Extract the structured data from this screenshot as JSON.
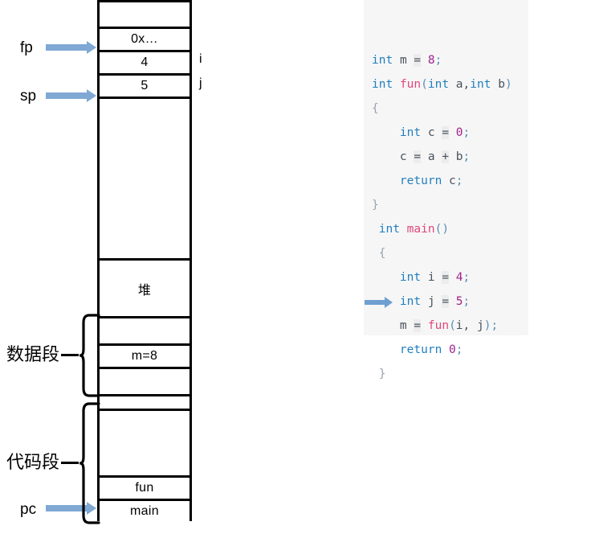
{
  "diagram": {
    "title": "stack-memory-layout",
    "pointer_labels": [
      {
        "name": "fp",
        "text": "fp"
      },
      {
        "name": "sp",
        "text": "sp"
      },
      {
        "name": "pc",
        "text": "pc"
      }
    ],
    "segment_labels": [
      {
        "name": "data-segment",
        "text": "数据段"
      },
      {
        "name": "code-segment",
        "text": "代码段"
      }
    ],
    "side_labels": [
      {
        "name": "var-i",
        "text": "i"
      },
      {
        "name": "var-j",
        "text": "j"
      }
    ],
    "cells": [
      {
        "name": "cell-empty-top",
        "text": ""
      },
      {
        "name": "cell-return-address",
        "text": "0x…"
      },
      {
        "name": "cell-i-value",
        "text": "4"
      },
      {
        "name": "cell-j-value",
        "text": "5"
      },
      {
        "name": "cell-stack-free",
        "text": ""
      },
      {
        "name": "cell-heap",
        "text": "堆"
      },
      {
        "name": "cell-data-upper",
        "text": ""
      },
      {
        "name": "cell-global-m",
        "text": "m=8"
      },
      {
        "name": "cell-data-lower",
        "text": ""
      },
      {
        "name": "cell-gap",
        "text": ""
      },
      {
        "name": "cell-code-free",
        "text": ""
      },
      {
        "name": "cell-fun",
        "text": "fun"
      },
      {
        "name": "cell-main",
        "text": "main"
      }
    ]
  },
  "code_panel": {
    "name": "source-code-panel",
    "language": "c",
    "current_line_index": 10,
    "lines": [
      [
        {
          "t": "int",
          "c": "kw"
        },
        {
          "t": " ",
          "c": "pl"
        },
        {
          "t": "m",
          "c": "pl"
        },
        {
          "t": " ",
          "c": "pl"
        },
        {
          "t": "=",
          "c": "op"
        },
        {
          "t": " ",
          "c": "pl"
        },
        {
          "t": "8",
          "c": "num"
        },
        {
          "t": ";",
          "c": "sem"
        }
      ],
      [
        {
          "t": "int",
          "c": "kw"
        },
        {
          "t": " ",
          "c": "pl"
        },
        {
          "t": "fun",
          "c": "fn"
        },
        {
          "t": "(",
          "c": "sem"
        },
        {
          "t": "int",
          "c": "kw"
        },
        {
          "t": " a,",
          "c": "pl"
        },
        {
          "t": "int",
          "c": "kw"
        },
        {
          "t": " b",
          "c": "pl"
        },
        {
          "t": ")",
          "c": "sem"
        }
      ],
      [
        {
          "t": "{",
          "c": "brc"
        }
      ],
      [
        {
          "t": "    ",
          "c": "pl"
        },
        {
          "t": "int",
          "c": "kw"
        },
        {
          "t": " ",
          "c": "pl"
        },
        {
          "t": "c",
          "c": "pl"
        },
        {
          "t": " ",
          "c": "pl"
        },
        {
          "t": "=",
          "c": "op"
        },
        {
          "t": " ",
          "c": "pl"
        },
        {
          "t": "0",
          "c": "num"
        },
        {
          "t": ";",
          "c": "sem"
        }
      ],
      [
        {
          "t": "    ",
          "c": "pl"
        },
        {
          "t": "c",
          "c": "pl"
        },
        {
          "t": " ",
          "c": "pl"
        },
        {
          "t": "=",
          "c": "op"
        },
        {
          "t": " a ",
          "c": "pl"
        },
        {
          "t": "+",
          "c": "op"
        },
        {
          "t": " b",
          "c": "pl"
        },
        {
          "t": ";",
          "c": "sem"
        }
      ],
      [
        {
          "t": "    ",
          "c": "pl"
        },
        {
          "t": "return",
          "c": "kw"
        },
        {
          "t": " c",
          "c": "pl"
        },
        {
          "t": ";",
          "c": "sem"
        }
      ],
      [
        {
          "t": "}",
          "c": "brc"
        }
      ],
      [
        {
          "t": " ",
          "c": "pl"
        },
        {
          "t": "int",
          "c": "kw"
        },
        {
          "t": " ",
          "c": "pl"
        },
        {
          "t": "main",
          "c": "fn"
        },
        {
          "t": "()",
          "c": "sem"
        }
      ],
      [
        {
          "t": " ",
          "c": "pl"
        },
        {
          "t": "{",
          "c": "brc"
        }
      ],
      [
        {
          "t": "    ",
          "c": "pl"
        },
        {
          "t": "int",
          "c": "kw"
        },
        {
          "t": " ",
          "c": "pl"
        },
        {
          "t": "i",
          "c": "pl"
        },
        {
          "t": " ",
          "c": "pl"
        },
        {
          "t": "=",
          "c": "op"
        },
        {
          "t": " ",
          "c": "pl"
        },
        {
          "t": "4",
          "c": "num"
        },
        {
          "t": ";",
          "c": "sem"
        }
      ],
      [
        {
          "t": "    ",
          "c": "pl"
        },
        {
          "t": "int",
          "c": "kw"
        },
        {
          "t": " ",
          "c": "pl"
        },
        {
          "t": "j",
          "c": "pl"
        },
        {
          "t": " ",
          "c": "pl"
        },
        {
          "t": "=",
          "c": "op"
        },
        {
          "t": " ",
          "c": "pl"
        },
        {
          "t": "5",
          "c": "num"
        },
        {
          "t": ";",
          "c": "sem"
        }
      ],
      [
        {
          "t": "    ",
          "c": "pl"
        },
        {
          "t": "m",
          "c": "pl"
        },
        {
          "t": " ",
          "c": "pl"
        },
        {
          "t": "=",
          "c": "op"
        },
        {
          "t": " ",
          "c": "pl"
        },
        {
          "t": "fun",
          "c": "fn"
        },
        {
          "t": "(",
          "c": "sem"
        },
        {
          "t": "i, j",
          "c": "pl"
        },
        {
          "t": ")",
          "c": "sem"
        },
        {
          "t": ";",
          "c": "sem"
        }
      ],
      [
        {
          "t": "    ",
          "c": "pl"
        },
        {
          "t": "return",
          "c": "kw"
        },
        {
          "t": " ",
          "c": "pl"
        },
        {
          "t": "0",
          "c": "num"
        },
        {
          "t": ";",
          "c": "sem"
        }
      ],
      [
        {
          "t": " ",
          "c": "pl"
        },
        {
          "t": "}",
          "c": "brc"
        }
      ]
    ]
  },
  "colors": {
    "arrow_blue": "#7fa8d4",
    "code_bg": "#f6f6f6",
    "keyword": "#1f7fbf",
    "function": "#e0467c",
    "number": "#a0228c",
    "plain": "#49525c",
    "brace": "#9aa3ab",
    "border": "#000000"
  }
}
